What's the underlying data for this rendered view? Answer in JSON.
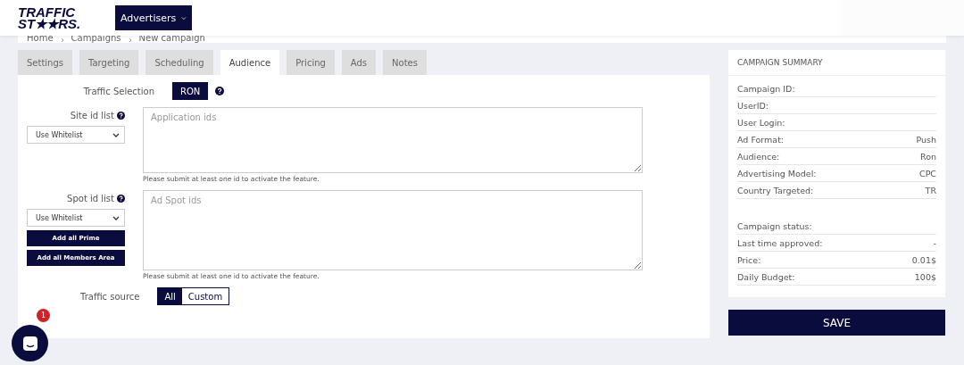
{
  "header": {
    "logo_line1": "TRAFFIC",
    "logo_line2": "ST★★RS.",
    "menu": "Advertisers"
  },
  "breadcrumb": [
    "Home",
    "Campaigns",
    "New campaign"
  ],
  "tabs": [
    {
      "label": "Settings",
      "selected": false
    },
    {
      "label": "Targeting",
      "selected": false
    },
    {
      "label": "Scheduling",
      "selected": false
    },
    {
      "label": "Audience",
      "selected": true
    },
    {
      "label": "Pricing",
      "selected": false
    },
    {
      "label": "Ads",
      "selected": false
    },
    {
      "label": "Notes",
      "selected": false
    }
  ],
  "traffic_selection": {
    "label": "Traffic Selection",
    "value": "RON"
  },
  "lists": [
    {
      "label": "Site id list",
      "select": "Use Whitelist",
      "placeholder": "Application ids",
      "hint": "Please submit at least one id to activate the feature."
    },
    {
      "label": "Spot id list",
      "select": "Use Whitelist",
      "placeholder": "Ad Spot ids",
      "buttons": [
        "Add all Prime",
        "Add all Members Area"
      ],
      "hint": "Please submit at least one id to activate the feature."
    }
  ],
  "traffic_source": {
    "label": "Traffic source",
    "options": [
      {
        "label": "All",
        "selected": true
      },
      {
        "label": "Custom",
        "selected": false
      }
    ]
  },
  "chat": {
    "badge": "1"
  },
  "summary": {
    "title": "CAMPAIGN SUMMARY",
    "groups": [
      [
        {
          "label": "Campaign ID:"
        },
        {
          "label": "UserID:"
        },
        {
          "label": "User Login:"
        },
        {
          "label": "Ad Format:",
          "value": "Push"
        },
        {
          "label": "Audience:",
          "value": "Ron"
        },
        {
          "label": "Advertising Model:",
          "value": "CPC"
        },
        {
          "label": "Country Targeted:",
          "value": "TR"
        }
      ],
      [
        {
          "label": "Campaign status:"
        },
        {
          "label": "Last time approved:",
          "value": "-"
        },
        {
          "label": "Price:",
          "value": "0.01$"
        },
        {
          "label": "Daily Budget:",
          "value": "100$"
        }
      ]
    ]
  },
  "save": "SAVE"
}
